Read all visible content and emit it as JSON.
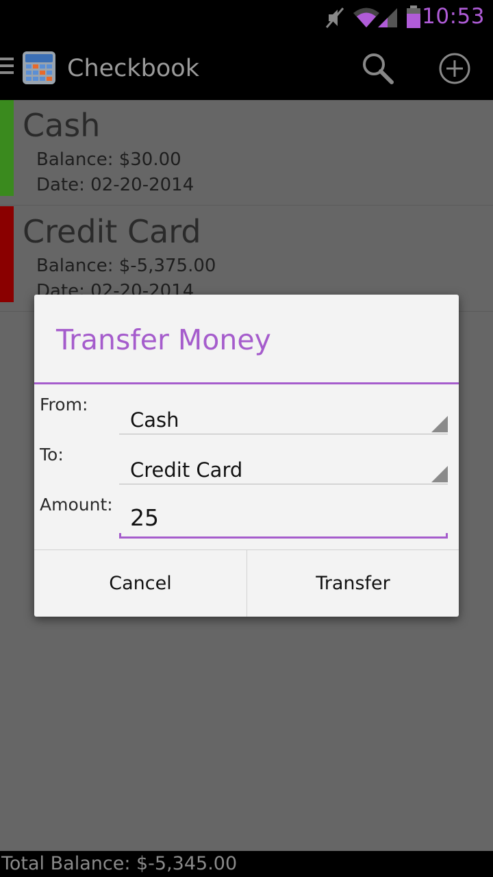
{
  "status_bar": {
    "time": "10:53",
    "icons": [
      "mute-icon",
      "wifi-icon",
      "signal-icon",
      "battery-icon"
    ],
    "accent_color": "#b05cd8"
  },
  "action_bar": {
    "title": "Checkbook",
    "icons": [
      "drawer-icon",
      "calculator-app-icon",
      "search-icon",
      "add-circle-icon"
    ]
  },
  "accounts": [
    {
      "name": "Cash",
      "balance": "Balance: $30.00",
      "date": "Date: 02-20-2014",
      "color": "#3a8a1e"
    },
    {
      "name": "Credit Card",
      "balance": "Balance: $-5,375.00",
      "date": "Date: 02-20-2014",
      "color": "#8a0000"
    }
  ],
  "footer": {
    "total": "Total Balance: $-5,345.00"
  },
  "dialog": {
    "title": "Transfer Money",
    "accent_color": "#a55ccc",
    "from_label": "From:",
    "from_value": "Cash",
    "to_label": "To:",
    "to_value": "Credit Card",
    "amount_label": "Amount:",
    "amount_value": "25",
    "cancel_label": "Cancel",
    "transfer_label": "Transfer"
  }
}
